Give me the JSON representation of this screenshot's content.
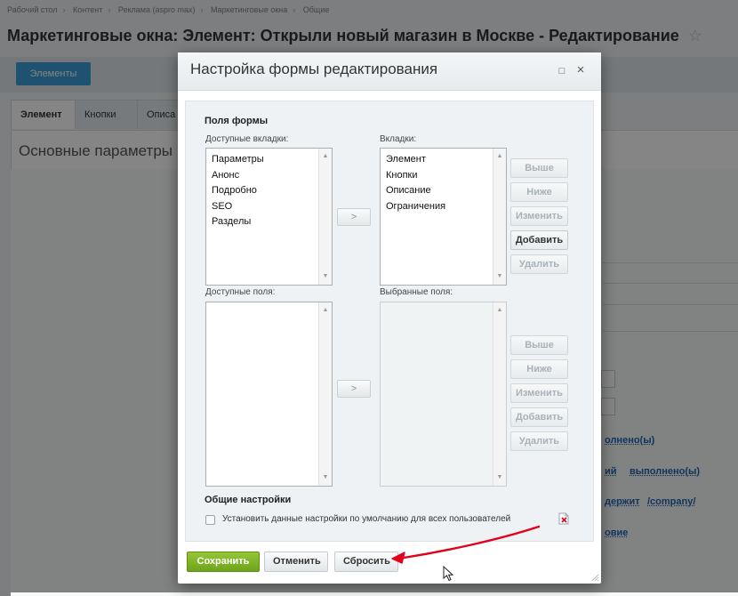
{
  "background": {
    "breadcrumb": [
      "Рабочий стол",
      "Контент",
      "Реклама (aspro max)",
      "Маркетинговые окна",
      "Общие"
    ],
    "page_title": "Маркетинговые окна: Элемент: Открыли новый магазин в Москве - Редактирование",
    "star_icon": "☆",
    "elements_button": "Элементы",
    "tabs": [
      "Элемент",
      "Кнопки",
      "Описа"
    ],
    "section_title": "Основные параметры",
    "right_fragments": {
      "r1": "олнено(ы)",
      "r2a": "ий",
      "r2b": "выполнено(ы)",
      "r3a": "держит",
      "r3b": "/company/",
      "r4": "овие"
    }
  },
  "dialog": {
    "title": "Настройка формы редактирования",
    "maximize_icon": "□",
    "close_icon": "×",
    "form_fields_heading": "Поля формы",
    "available_tabs_label": "Доступные вкладки:",
    "available_tabs": [
      "Параметры",
      "Анонс",
      "Подробно",
      "SEO",
      "Разделы"
    ],
    "tabs_label": "Вкладки:",
    "tabs": [
      "Элемент",
      "Кнопки",
      "Описание",
      "Ограничения"
    ],
    "available_fields_label": "Доступные поля:",
    "selected_fields_label": "Выбранные поля:",
    "move_button": ">",
    "tab_buttons": {
      "up": "Выше",
      "down": "Ниже",
      "edit": "Изменить",
      "add": "Добавить",
      "delete": "Удалить"
    },
    "field_buttons": {
      "up": "Выше",
      "down": "Ниже",
      "edit": "Изменить",
      "add": "Добавить",
      "delete": "Удалить"
    },
    "general_settings_heading": "Общие настройки",
    "default_checkbox_label": "Установить данные настройки по умолчанию для всех пользователей",
    "save_button": "Сохранить",
    "cancel_button": "Отменить",
    "reset_button": "Сбросить"
  },
  "colors": {
    "save_green": "#7ab026",
    "annotation_red": "#e2001a",
    "link_blue": "#2067b0"
  }
}
